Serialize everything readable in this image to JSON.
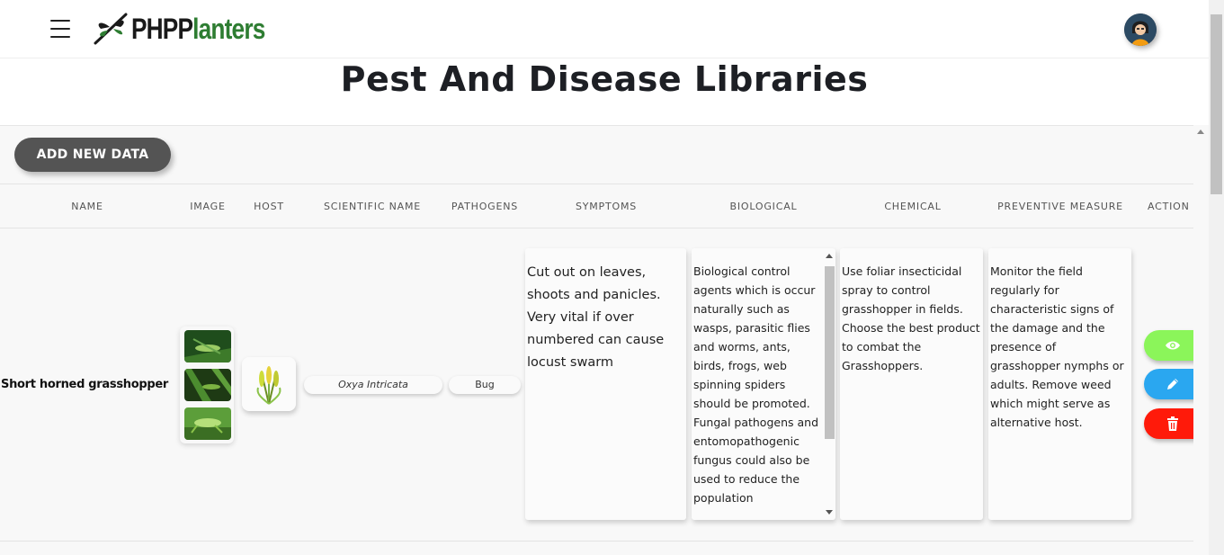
{
  "header": {
    "logo_text_a": "PHP",
    "logo_text_b": "lanters",
    "logo_text_p": "P"
  },
  "page": {
    "title": "Pest And Disease Libraries",
    "add_button_label": "ADD NEW DATA"
  },
  "table": {
    "columns": [
      "NAME",
      "IMAGE",
      "HOST",
      "SCIENTIFIC NAME",
      "PATHOGENS",
      "SYMPTOMS",
      "BIOLOGICAL",
      "CHEMICAL",
      "PREVENTIVE MEASURE",
      "ACTION"
    ],
    "rows": [
      {
        "name": "Short horned grasshopper",
        "scientific_name": "Oxya Intricata",
        "pathogens": "Bug",
        "symptoms": "Cut out on leaves, shoots and panicles. Very vital if over numbered can cause locust swarm",
        "biological": "Biological control agents which is occur naturally such as wasps, parasitic flies and worms, ants, birds, frogs, web spinning spiders should be promoted. Fungal pathogens and entomopathogenic fungus could also be used to reduce the population",
        "chemical": "Use foliar insecticidal spray to control grasshopper in fields. Choose the best product to combat the Grasshoppers.",
        "preventive": "Monitor the field regularly for characteristic signs of the damage and the presence of grasshopper nymphs or adults.  Remove weed which might serve as alternative host."
      }
    ]
  },
  "actions": {
    "view_icon": "eye-icon",
    "edit_icon": "pencil-icon",
    "delete_icon": "trash-icon",
    "view_color": "#8bf55a",
    "edit_color": "#2aa7f0",
    "delete_color": "#ff1a0a"
  }
}
